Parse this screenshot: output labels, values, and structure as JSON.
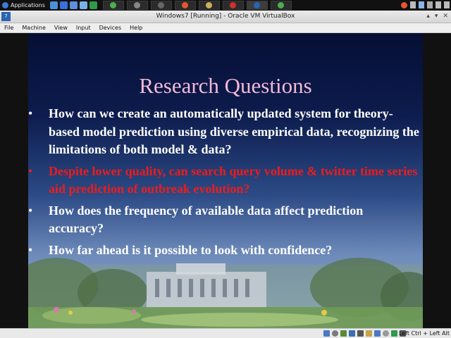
{
  "host_panel": {
    "apps_label": "Applications",
    "launchers": [
      {
        "icon": "file-manager-icon",
        "color": "#4a90d9"
      },
      {
        "icon": "browser-icon",
        "color": "#3a6fd8"
      },
      {
        "icon": "bluetooth-icon",
        "color": "#5d8ee0"
      },
      {
        "icon": "text-editor-icon",
        "color": "#7ab0e8"
      },
      {
        "icon": "terminal-icon",
        "color": "#2f9a4a"
      }
    ],
    "tasks": [
      {
        "icon": "chrome-icon",
        "color": "#4caf50"
      },
      {
        "icon": "window-icon",
        "color": "#888888"
      },
      {
        "icon": "terminal-icon",
        "color": "#666666"
      },
      {
        "icon": "chrome-icon",
        "color": "#e4572e"
      },
      {
        "icon": "folder-icon",
        "color": "#c9b15a"
      },
      {
        "icon": "document-icon",
        "color": "#d22f2f"
      },
      {
        "icon": "virtualbox-icon",
        "color": "#2a64b2"
      },
      {
        "icon": "chrome-icon",
        "color": "#4caf50"
      }
    ],
    "tray": [
      {
        "icon": "chrome-icon",
        "color": "#e4572e"
      },
      {
        "icon": "network-icon",
        "color": "#bbbbbb"
      },
      {
        "icon": "dropbox-icon",
        "color": "#8ab4ee"
      },
      {
        "icon": "bluetooth-icon",
        "color": "#aaaaaa"
      },
      {
        "icon": "volume-icon",
        "color": "#bbbbbb"
      },
      {
        "icon": "power-icon",
        "color": "#bbbbbb"
      }
    ]
  },
  "window": {
    "title": "Windows7 [Running] - Oracle VM VirtualBox",
    "logo_text": "7",
    "menu": [
      "File",
      "Machine",
      "View",
      "Input",
      "Devices",
      "Help"
    ]
  },
  "slide": {
    "title": "Research Questions",
    "bullet_symbol": "•",
    "bullets": [
      {
        "text": "How can we create an automatically updated system for theory-based model prediction using diverse empirical data, recognizing the limitations of both model & data?",
        "color": "#ffffff"
      },
      {
        "text": "Despite lower quality, can search query volume & twitter time series aid prediction of outbreak evolution?",
        "color": "#ee1c1c"
      },
      {
        "text": "How does the frequency of available data affect prediction accuracy?",
        "color": "#ffffff"
      },
      {
        "text": "How far ahead is it possible to look with confidence?",
        "color": "#ffffff"
      }
    ]
  },
  "statusbar": {
    "icons": [
      {
        "icon": "hard-disk-icon",
        "color": "#4a78c2"
      },
      {
        "icon": "optical-drive-icon",
        "color": "#7a7a7a"
      },
      {
        "icon": "audio-icon",
        "color": "#5a8a3a"
      },
      {
        "icon": "network-adapter-icon",
        "color": "#3a6fb0"
      },
      {
        "icon": "usb-icon",
        "color": "#555555"
      },
      {
        "icon": "shared-folders-icon",
        "color": "#c9a24a"
      },
      {
        "icon": "display-icon",
        "color": "#4a78c2"
      },
      {
        "icon": "recording-icon",
        "color": "#999999"
      },
      {
        "icon": "mouse-integration-icon",
        "color": "#2f9a4a"
      },
      {
        "icon": "keyboard-icon",
        "color": "#555555"
      }
    ],
    "host_key": "Left Ctrl + Left Alt"
  }
}
